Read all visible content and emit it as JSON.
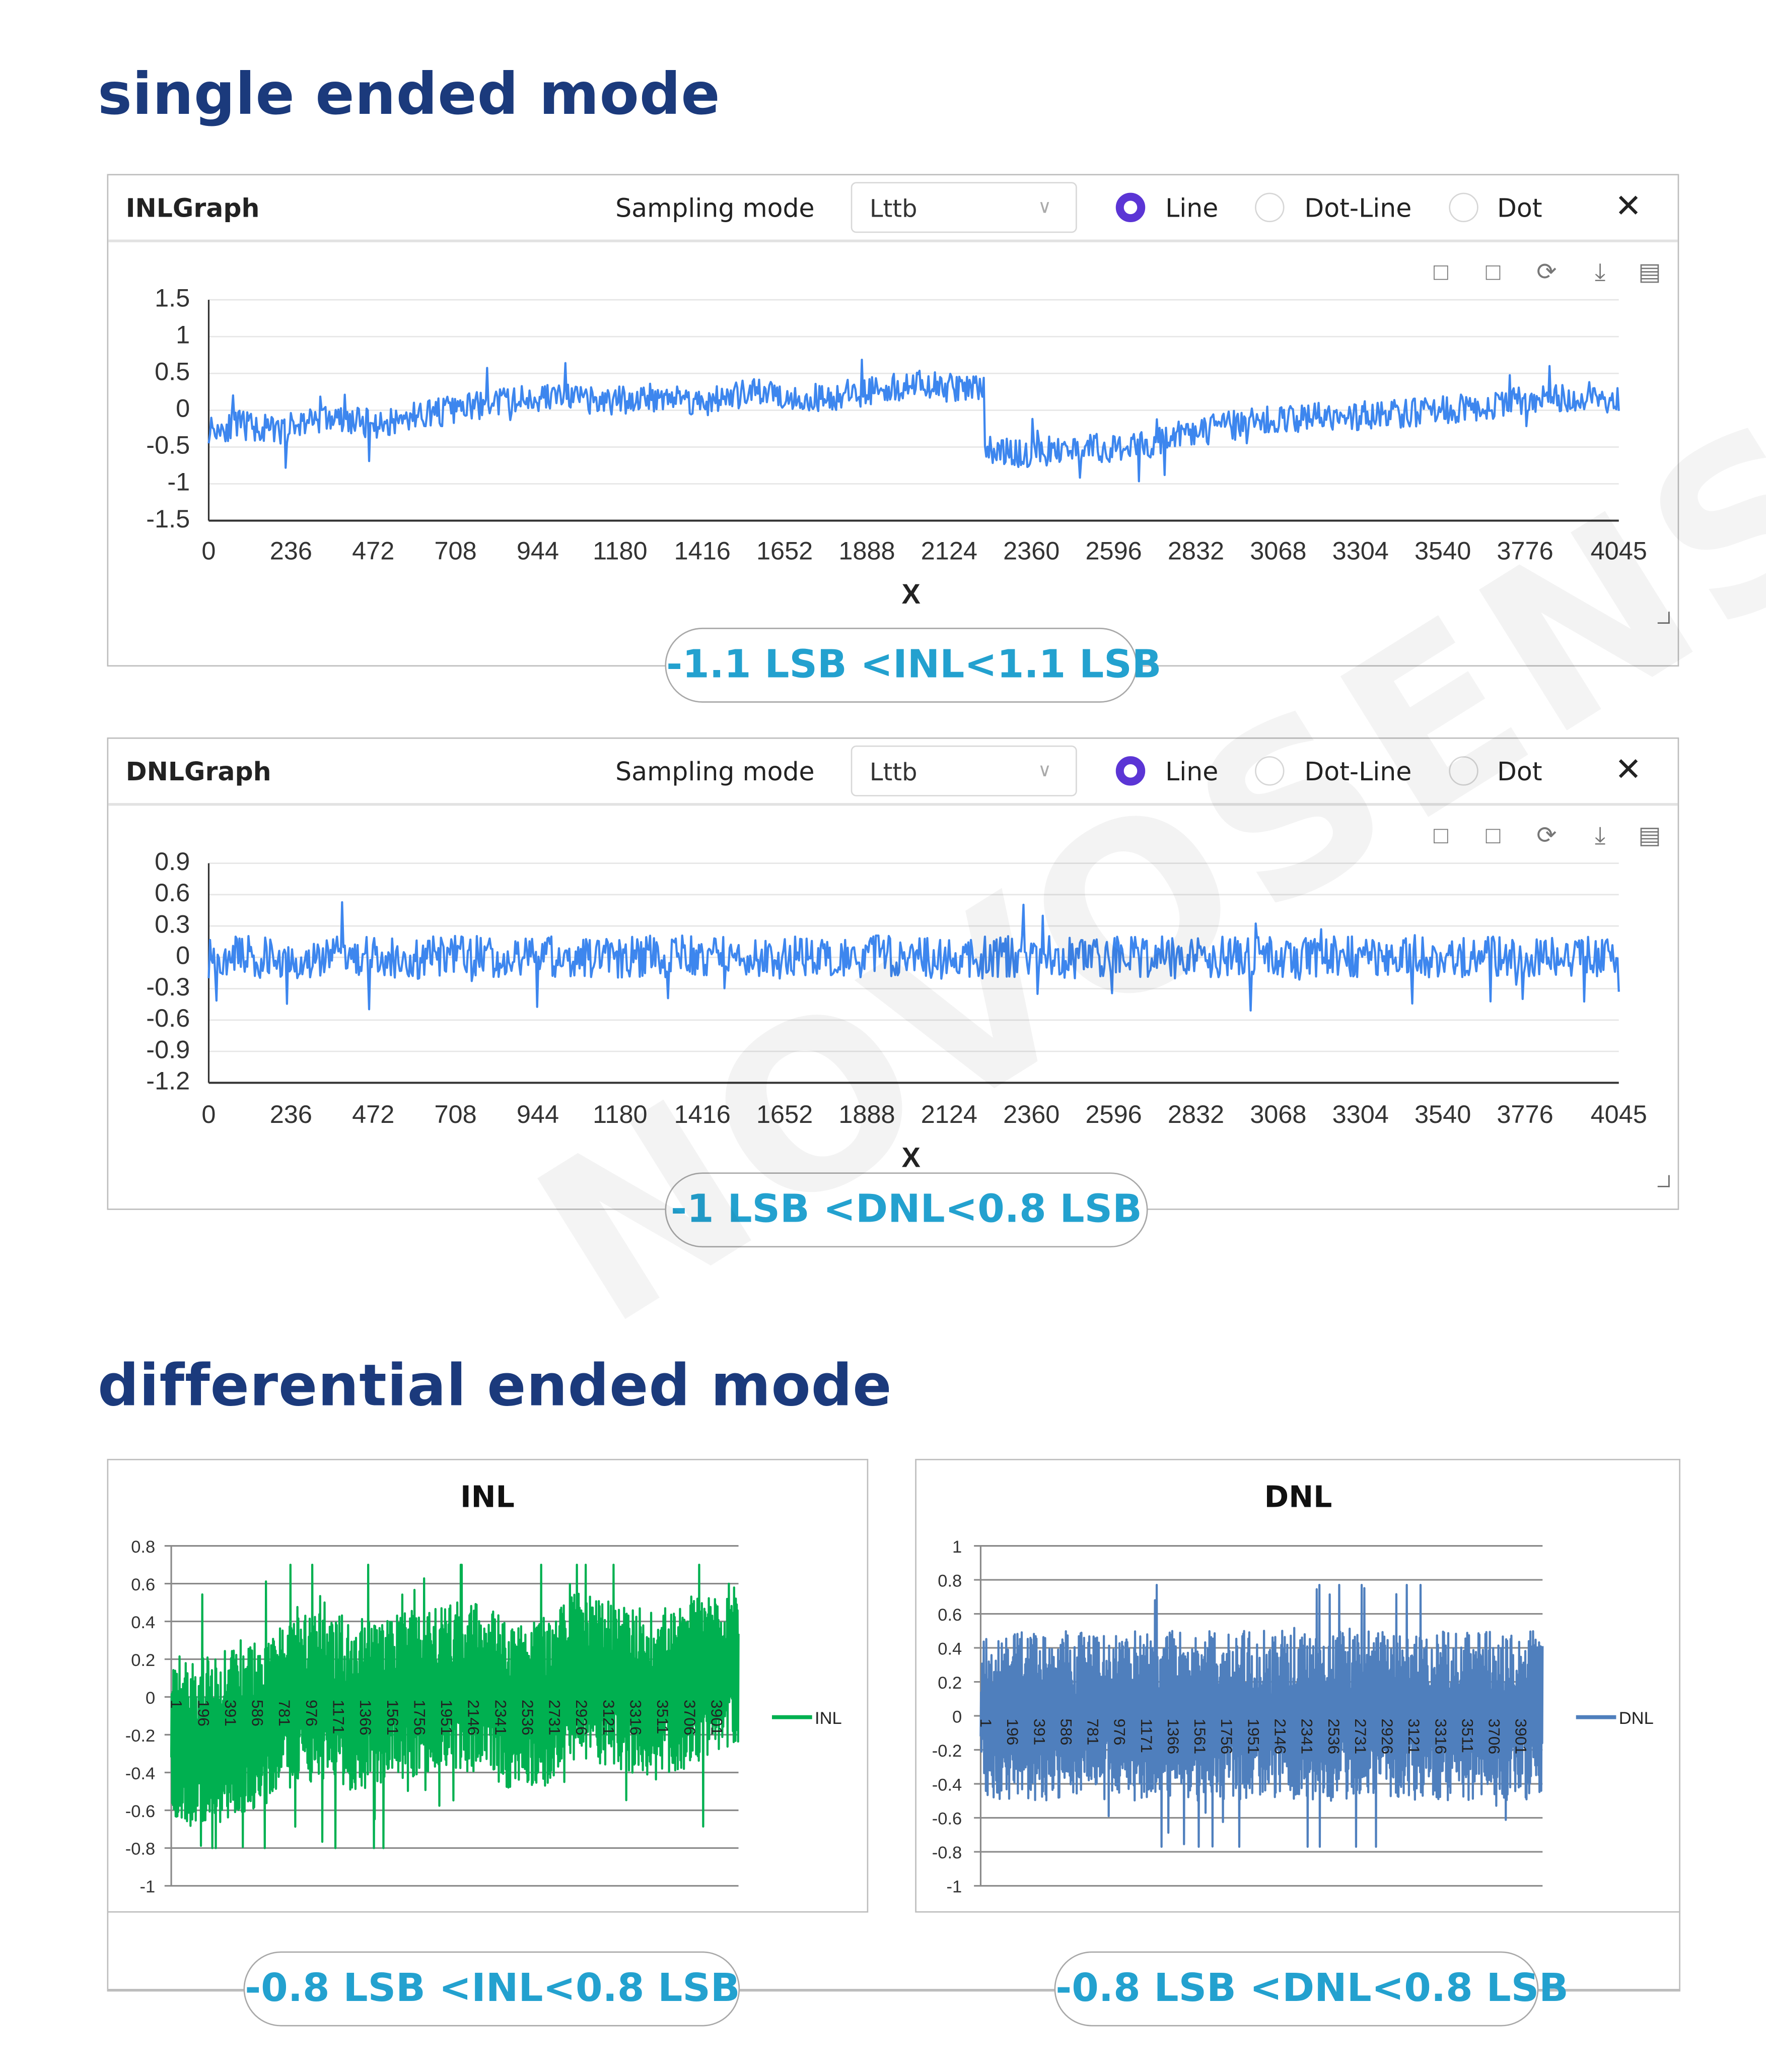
{
  "sections": {
    "single_title": "single ended mode",
    "diff_title": "differential ended mode"
  },
  "inl_panel": {
    "title": "INLGraph",
    "sampling_label": "Sampling mode",
    "sampling_value": "Lttb",
    "radio_options": [
      "Line",
      "Dot-Line",
      "Dot"
    ],
    "selected": "Line",
    "close": "✕",
    "tools": [
      "zoom-select-icon",
      "zoom-reset-icon",
      "refresh-icon",
      "download-icon",
      "save-icon"
    ],
    "badge": "-1.1 LSB <INL<1.1 LSB"
  },
  "dnl_panel": {
    "title": "DNLGraph",
    "sampling_label": "Sampling mode",
    "sampling_value": "Lttb",
    "radio_options": [
      "Line",
      "Dot-Line",
      "Dot"
    ],
    "selected": "Line",
    "close": "✕",
    "tools": [
      "zoom-select-icon",
      "zoom-reset-icon",
      "refresh-icon",
      "download-icon",
      "save-icon"
    ],
    "badge": "-1 LSB <DNL<0.8 LSB"
  },
  "diff_badges": {
    "inl": "-0.8 LSB <INL<0.8 LSB",
    "dnl": "-0.8 LSB <DNL<0.8 LSB"
  },
  "watermark": "NOVOSENSE",
  "colors": {
    "title": "#1b3a7c",
    "badge_text": "#23a1cf",
    "radio_selected": "#5b35d5",
    "single_series": "#3d86ee",
    "diff_inl": "#00b050",
    "diff_dnl": "#4f7fbd"
  },
  "chart_data": [
    {
      "type": "line",
      "title": "",
      "xlabel": "X",
      "ylabel": "",
      "xlim": [
        0,
        4045
      ],
      "ylim": [
        -1.5,
        1.5
      ],
      "yticks": [
        "1.5",
        "1",
        "0.5",
        "0",
        "-0.5",
        "-1",
        "-1.5"
      ],
      "ytick_values": [
        1.5,
        1,
        0.5,
        0,
        -0.5,
        -1,
        -1.5
      ],
      "xticks": [
        "0",
        "236",
        "472",
        "708",
        "944",
        "1180",
        "1416",
        "1652",
        "1888",
        "2124",
        "2360",
        "2596",
        "2832",
        "3068",
        "3304",
        "3540",
        "3776",
        "4045"
      ],
      "grid": true,
      "series": [
        {
          "values_approx_every_101": [
            -0.25,
            -0.2,
            -0.3,
            -0.1,
            -0.15,
            -0.2,
            -0.05,
            0,
            0.1,
            0.15,
            0.2,
            0.1,
            0.15,
            0.2,
            0.1,
            0.2,
            0.25,
            0.15,
            0.2,
            0.3,
            0.35,
            0.3,
            -0.5,
            -0.6,
            -0.55,
            -0.5,
            -0.55,
            -0.4,
            -0.3,
            -0.2,
            -0.15,
            -0.1,
            -0.1,
            -0.05,
            -0.05,
            0,
            0.05,
            0.1,
            0.15,
            0.2,
            0.15
          ],
          "min": -1.1,
          "max": 1.1
        }
      ]
    },
    {
      "type": "line",
      "title": "",
      "xlabel": "X",
      "ylabel": "",
      "xlim": [
        0,
        4045
      ],
      "ylim": [
        -1.2,
        0.9
      ],
      "yticks": [
        "0.9",
        "0.6",
        "0.3",
        "0",
        "-0.3",
        "-0.6",
        "-0.9",
        "-1.2"
      ],
      "ytick_values": [
        0.9,
        0.6,
        0.3,
        0,
        -0.3,
        -0.6,
        -0.9,
        -1.2
      ],
      "xticks": [
        "0",
        "236",
        "472",
        "708",
        "944",
        "1180",
        "1416",
        "1652",
        "1888",
        "2124",
        "2360",
        "2596",
        "2832",
        "3068",
        "3304",
        "3540",
        "3776",
        "4045"
      ],
      "grid": true,
      "series": [
        {
          "values_approx_every_101": [
            0,
            0.02,
            -0.02,
            0,
            0.01,
            0,
            -0.01,
            0.02,
            0,
            0,
            0.01,
            -0.02,
            0,
            0.02,
            0,
            0,
            -0.01,
            0.01,
            0,
            0.02,
            0,
            -0.02,
            0,
            0.01,
            0,
            0,
            0.02,
            0,
            -0.01,
            0,
            0.01,
            0,
            0,
            0.02,
            0,
            -0.01,
            0,
            0.01,
            0.02,
            0,
            0
          ],
          "min": -1.0,
          "max": 0.8
        }
      ]
    },
    {
      "type": "line",
      "title": "INL",
      "xlabel": "",
      "ylabel": "",
      "legend": "right",
      "ylim": [
        -1,
        0.8
      ],
      "yticks": [
        "0.8",
        "0.6",
        "0.4",
        "0.2",
        "0",
        "-0.2",
        "-0.4",
        "-0.6",
        "-0.8",
        "-1"
      ],
      "ytick_values": [
        0.8,
        0.6,
        0.4,
        0.2,
        0,
        -0.2,
        -0.4,
        -0.6,
        -0.8,
        -1
      ],
      "xticks": [
        "1",
        "196",
        "391",
        "586",
        "781",
        "976",
        "1171",
        "1366",
        "1561",
        "1756",
        "1951",
        "2146",
        "2341",
        "2536",
        "2731",
        "2926",
        "3121",
        "3316",
        "3511",
        "3706",
        "3901"
      ],
      "xlim": [
        1,
        4096
      ],
      "grid": true,
      "series": [
        {
          "name": "INL",
          "values_approx_every_205": [
            -0.2,
            -0.25,
            -0.2,
            -0.15,
            -0.05,
            0,
            -0.05,
            -0.05,
            0,
            0.05,
            0.05,
            0.05,
            -0.05,
            -0.05,
            0.1,
            0.1,
            0.05,
            0.0,
            0.05,
            0.15,
            0.15
          ],
          "min": -0.8,
          "max": 0.7
        }
      ]
    },
    {
      "type": "line",
      "title": "DNL",
      "xlabel": "",
      "ylabel": "",
      "legend": "right",
      "ylim": [
        -1,
        1
      ],
      "yticks": [
        "1",
        "0.8",
        "0.6",
        "0.4",
        "0.2",
        "0",
        "-0.2",
        "-0.4",
        "-0.6",
        "-0.8",
        "-1"
      ],
      "ytick_values": [
        1,
        0.8,
        0.6,
        0.4,
        0.2,
        0,
        -0.2,
        -0.4,
        -0.6,
        -0.8,
        -1
      ],
      "xticks": [
        "1",
        "196",
        "391",
        "586",
        "781",
        "976",
        "1171",
        "1366",
        "1561",
        "1756",
        "1951",
        "2146",
        "2341",
        "2536",
        "2731",
        "2926",
        "3121",
        "3316",
        "3511",
        "3706",
        "3901"
      ],
      "xlim": [
        1,
        4096
      ],
      "grid": true,
      "series": [
        {
          "name": "DNL",
          "values_approx_every_205": [
            0,
            0,
            0,
            0,
            0,
            0,
            0,
            0,
            0,
            0,
            0,
            0,
            0,
            0,
            0,
            0,
            0,
            0,
            0,
            0,
            0
          ],
          "min": -0.77,
          "max": 0.77
        }
      ]
    }
  ]
}
